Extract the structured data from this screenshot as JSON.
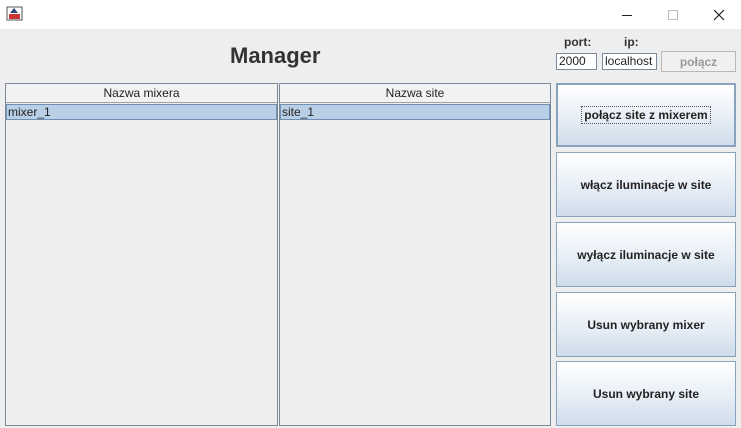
{
  "window": {
    "icons": {
      "app": "java-app-icon",
      "minimize": "minimize-icon",
      "maximize": "maximize-icon",
      "close": "close-icon"
    }
  },
  "header": {
    "title": "Manager"
  },
  "connection": {
    "port_label": "port:",
    "ip_label": "ip:",
    "port_value": "2000",
    "ip_value": "localhost",
    "connect_label": "połącz"
  },
  "mixers_table": {
    "header": "Nazwa mixera",
    "rows": [
      "mixer_1"
    ]
  },
  "sites_table": {
    "header": "Nazwa site",
    "rows": [
      "site_1"
    ]
  },
  "actions": {
    "link": "połącz site z mixerem",
    "enable": "włącz iluminacje w site",
    "disable": "wyłącz iluminacje w site",
    "remove_mixer": "Usun wybrany mixer",
    "remove_site": "Usun wybrany site"
  },
  "colors": {
    "selection": "#b8cfe5",
    "background": "#eeeeee"
  }
}
